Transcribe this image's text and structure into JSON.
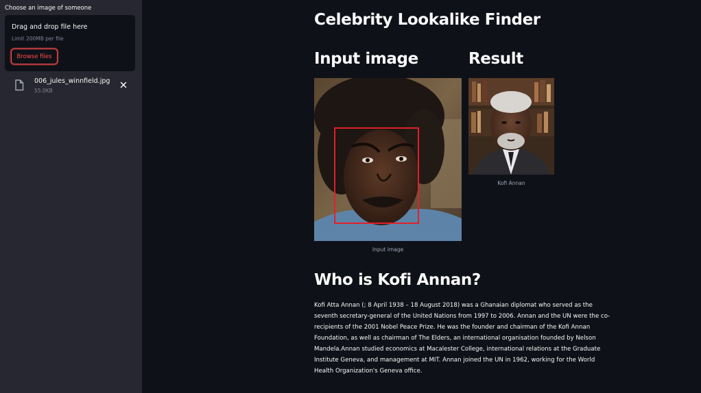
{
  "sidebar": {
    "uploader_label": "Choose an image of someone",
    "dropzone_title": "Drag and drop file here",
    "dropzone_limit": "Limit 200MB per file",
    "browse_button": "Browse files",
    "file": {
      "name": "006_jules_winnfield.jpg",
      "size": "55.0KB"
    }
  },
  "main": {
    "title": "Celebrity Lookalike Finder",
    "input_heading": "Input image",
    "result_heading": "Result",
    "input_caption": "Input image",
    "result_caption": "Kofi Annan",
    "who_heading": "Who is Kofi Annan?",
    "bio": "Kofi Atta Annan (; 8 April 1938 – 18 August 2018) was a Ghanaian diplomat who served as the seventh secretary-general of the United Nations from 1997 to 2006. Annan and the UN were the co-recipients of the 2001 Nobel Peace Prize. He was the founder and chairman of the Kofi Annan Foundation, as well as chairman of The Elders, an international organisation founded by Nelson Mandela.Annan studied economics at Macalester College, international relations at the Graduate Institute Geneva, and management at MIT. Annan joined the UN in 1962, working for the World Health Organization's Geneva office."
  },
  "colors": {
    "background": "#0e1117",
    "sidebar": "#262730",
    "accent": "#ff4b4b",
    "face_box": "#e0202a"
  }
}
